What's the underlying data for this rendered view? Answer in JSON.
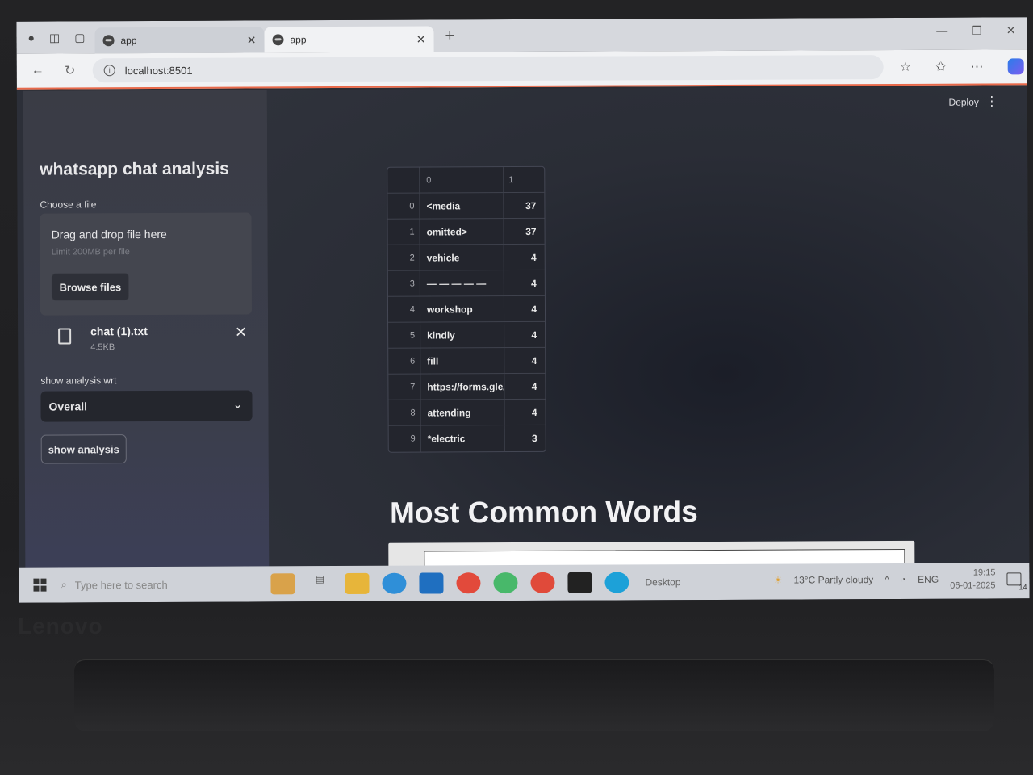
{
  "browser": {
    "tabs": [
      {
        "label": "app",
        "active": false
      },
      {
        "label": "app",
        "active": true
      }
    ],
    "new_tab": "+",
    "url": "localhost:8501"
  },
  "app": {
    "deploy_label": "Deploy",
    "sidebar": {
      "title": "whatsapp chat analysis",
      "file_label": "Choose a file",
      "dropzone_text": "Drag and drop file here",
      "dropzone_limit": "Limit 200MB per file",
      "browse_label": "Browse files",
      "uploaded_file": {
        "name": "chat (1).txt",
        "size": "4.5KB"
      },
      "select_label": "show analysis wrt",
      "select_value": "Overall",
      "show_button": "show analysis"
    },
    "table": {
      "columns": [
        "0",
        "1"
      ],
      "rows": [
        {
          "idx": "0",
          "word": "<media",
          "count": "37"
        },
        {
          "idx": "1",
          "word": "omitted>",
          "count": "37"
        },
        {
          "idx": "2",
          "word": "vehicle",
          "count": "4"
        },
        {
          "idx": "3",
          "word": "— — — — —",
          "count": "4"
        },
        {
          "idx": "4",
          "word": "workshop",
          "count": "4"
        },
        {
          "idx": "5",
          "word": "kindly",
          "count": "4"
        },
        {
          "idx": "6",
          "word": "fill",
          "count": "4"
        },
        {
          "idx": "7",
          "word": "https://forms.gle/",
          "count": "4"
        },
        {
          "idx": "8",
          "word": "attending",
          "count": "4"
        },
        {
          "idx": "9",
          "word": "*electric",
          "count": "3"
        }
      ]
    },
    "heading": "Most Common Words"
  },
  "taskbar": {
    "search_placeholder": "Type here to search",
    "desktop_label": "Desktop",
    "weather": "13°C  Partly cloudy",
    "lang": "ENG",
    "time": "19:15",
    "date": "06-01-2025",
    "notifications": "14"
  },
  "device": {
    "brand": "Lenovo"
  }
}
